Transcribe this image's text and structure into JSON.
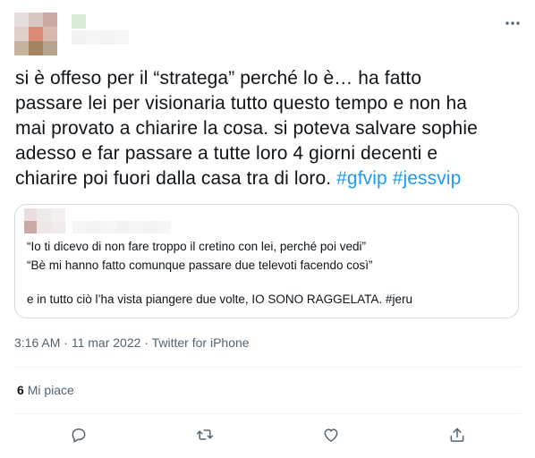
{
  "tweet": {
    "text_lines": [
      "si è offeso per il “stratega” perché lo è… ha fatto",
      "passare lei per visionaria tutto questo tempo e non ha",
      "mai provato a chiarire la cosa. si poteva salvare sophie",
      "adesso e far passare a tutte loro 4 giorni decenti e",
      "chiarire poi fuori dalla casa tra di loro. "
    ],
    "hashtags": [
      "#gfvip",
      "#jessvip"
    ],
    "quoted": {
      "lines": [
        "“Io ti dicevo di non fare troppo il cretino con lei, perché poi vedi”",
        "“Bè mi hanno fatto comunque passare due televoti facendo così”",
        "e in tutto ciò l’ha vista piangere due volte, IO SONO RAGGELATA. #jeru"
      ]
    },
    "time": "3:16 AM",
    "separator": "·",
    "date": "11 mar 2022",
    "source": "Twitter for iPhone",
    "likes_count": "6",
    "likes_label": "Mi piace"
  },
  "icons": {
    "more": "more-horizontal-icon",
    "reply": "reply-icon",
    "retweet": "retweet-icon",
    "like": "heart-icon",
    "share": "share-icon"
  },
  "colors": {
    "text": "#0f1419",
    "secondary": "#536471",
    "accent": "#1d9bf0",
    "border": "#cfd9de"
  }
}
